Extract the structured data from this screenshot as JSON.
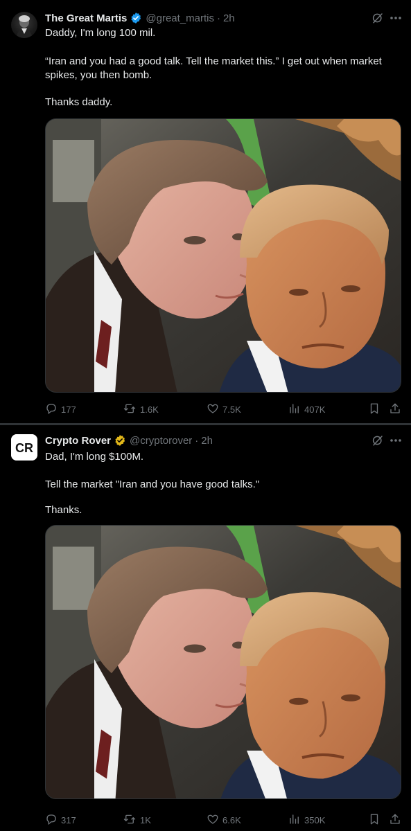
{
  "tweets": [
    {
      "name": "The Great Martis",
      "handle": "@great_martis",
      "time": "2h",
      "line1": "Daddy, I'm long 100 mil.",
      "line2": "“Iran and you had a good talk. Tell the market this.” I get out when market spikes, you then bomb.",
      "line3": "Thanks daddy.",
      "replies": "177",
      "reposts": "1.6K",
      "likes": "7.5K",
      "views": "407K",
      "badge_color": "#1d9bf0"
    },
    {
      "name": "Crypto Rover",
      "handle": "@cryptorover",
      "time": "2h",
      "line1": "Dad, I'm long $100M.",
      "line2": "Tell the market \"Iran and you have good talks.\"",
      "line3": "Thanks.",
      "replies": "317",
      "reposts": "1K",
      "likes": "6.6K",
      "views": "350K",
      "badge_color": "#e2b719",
      "avatar_text": "CR"
    }
  ],
  "colors": {
    "background": "#000000",
    "text_primary": "#e7e9ea",
    "text_secondary": "#71767b",
    "separator": "#2f3336"
  },
  "icons": [
    "verified-badge-icon",
    "grok-icon",
    "more-icon",
    "reply-icon",
    "repost-icon",
    "like-icon",
    "views-icon",
    "bookmark-icon",
    "share-icon"
  ]
}
